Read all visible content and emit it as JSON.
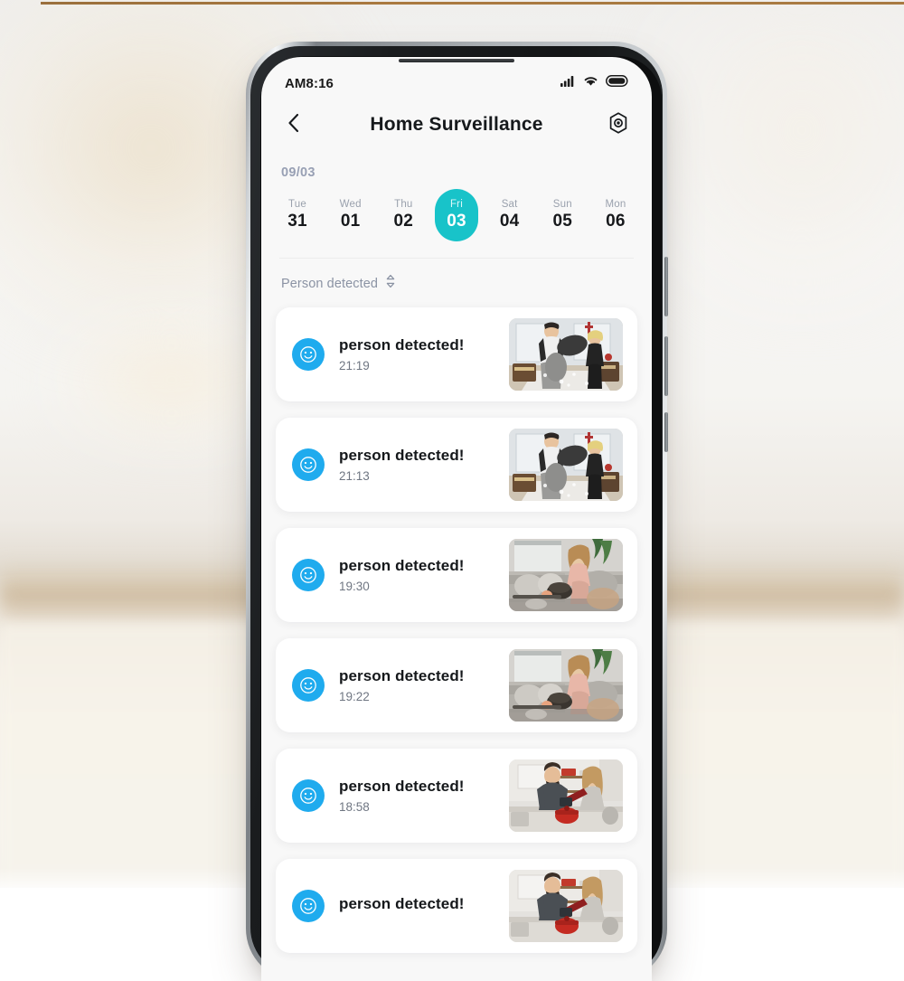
{
  "status_bar": {
    "time": "AM8:16",
    "icons": [
      "signal-icon",
      "wifi-icon",
      "battery-icon"
    ]
  },
  "header": {
    "back_icon": "chevron-left-icon",
    "title": "Home Surveillance",
    "settings_icon": "aperture-hexagon-icon"
  },
  "calendar": {
    "month_label": "09/03",
    "days": [
      {
        "dow": "Tue",
        "num": "31",
        "active": false
      },
      {
        "dow": "Wed",
        "num": "01",
        "active": false
      },
      {
        "dow": "Thu",
        "num": "02",
        "active": false
      },
      {
        "dow": "Fri",
        "num": "03",
        "active": true
      },
      {
        "dow": "Sat",
        "num": "04",
        "active": false
      },
      {
        "dow": "Sun",
        "num": "05",
        "active": false
      },
      {
        "dow": "Mon",
        "num": "06",
        "active": false
      }
    ],
    "active_color": "#18c3c9"
  },
  "filter": {
    "label": "Person detected",
    "chevron_icon": "chevron-up-down-icon"
  },
  "events": [
    {
      "title": "person detected!",
      "time": "21:19",
      "icon": "smiley-face-icon",
      "thumbnail": "pillow-fight-bedroom"
    },
    {
      "title": "person detected!",
      "time": "21:13",
      "icon": "smiley-face-icon",
      "thumbnail": "pillow-fight-bedroom"
    },
    {
      "title": "person detected!",
      "time": "19:30",
      "icon": "smiley-face-icon",
      "thumbnail": "woman-sofa-dog-livingroom"
    },
    {
      "title": "person detected!",
      "time": "19:22",
      "icon": "smiley-face-icon",
      "thumbnail": "woman-sofa-dog-livingroom"
    },
    {
      "title": "person detected!",
      "time": "18:58",
      "icon": "smiley-face-icon",
      "thumbnail": "couple-kitchen-cooking"
    },
    {
      "title": "person detected!",
      "time": "",
      "icon": "smiley-face-icon",
      "thumbnail": "couple-kitchen-cooking"
    }
  ],
  "colors": {
    "accent_teal": "#18c3c9",
    "icon_blue": "#1fabee",
    "card_white": "#ffffff",
    "screen_bg": "#f8f8f8",
    "muted_text": "#8b93a4",
    "top_rule": "#a8793f"
  }
}
